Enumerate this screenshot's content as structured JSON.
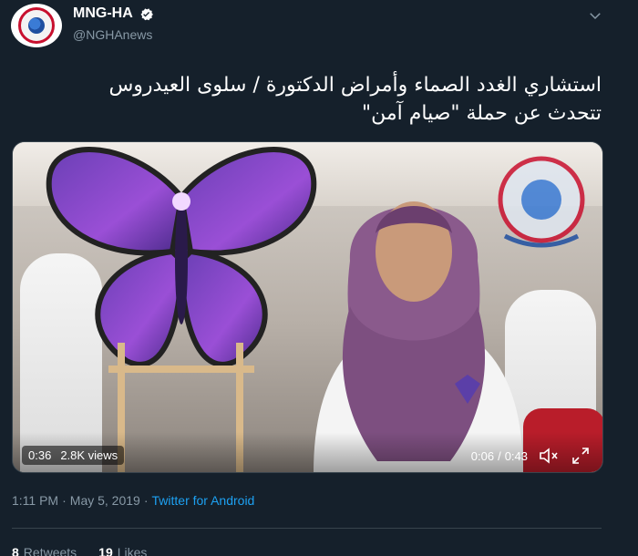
{
  "header": {
    "display_name": "MNG-HA",
    "handle": "@NGHAnews",
    "verified": true
  },
  "tweet": {
    "lines": [
      "استشاري الغدد الصماء وأمراض الدكتورة / سلوى العيدروس",
      "تتحدث عن حملة \"صيام آمن\""
    ]
  },
  "video": {
    "elapsed_badge": "0:36",
    "views": "2.8K views",
    "current_time": "0:06",
    "separator": "/",
    "duration": "0:43",
    "muted": true
  },
  "meta": {
    "time": "1:11 PM",
    "dot": "·",
    "date": "May 5, 2019",
    "source": "Twitter for Android"
  },
  "stats": {
    "retweets_count": "8",
    "retweets_label": "Retweets",
    "likes_count": "19",
    "likes_label": "Likes"
  },
  "colors": {
    "background": "#15202b",
    "secondary_text": "#8899a6",
    "link": "#1da1f2",
    "divider": "#38444d"
  },
  "icons": [
    "verified-badge-icon",
    "chevron-down-icon",
    "mute-icon",
    "fullscreen-icon"
  ]
}
